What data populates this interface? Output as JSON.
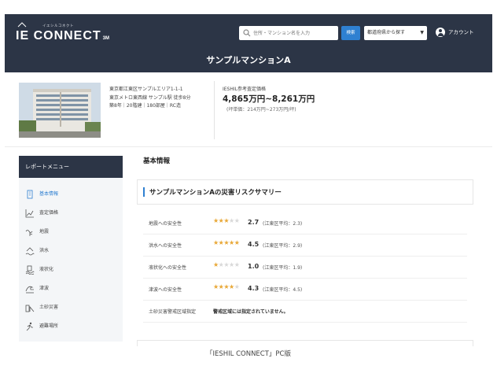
{
  "header": {
    "logo_kana": "イエシルコネクト",
    "logo_text": "IE CONNECT",
    "logo_sub": "3M",
    "search_placeholder": "住所・マンション名を入力",
    "search_button": "検索",
    "pref_button": "都道府県から探す",
    "account": "アカウント",
    "page_title": "サンプルマンションA"
  },
  "property": {
    "address_lines": [
      "東京都江東区サンプルエリア1-1-1",
      "東京メトロ東西線 サンプル駅 徒歩8分",
      "築8年｜20階建｜180部屋｜RC造"
    ],
    "price_label": "IESHIL参考査定価格",
    "price": "4,865万円~8,261万円",
    "price_sub": "(坪単価：214万円~273万円/坪)"
  },
  "sidebar": {
    "title": "レポートメニュー",
    "items": [
      {
        "label": "基本情報",
        "icon": "building-icon"
      },
      {
        "label": "査定価格",
        "icon": "chart-icon"
      },
      {
        "label": "地震",
        "icon": "earthquake-icon"
      },
      {
        "label": "洪水",
        "icon": "house-flood-icon"
      },
      {
        "label": "液状化",
        "icon": "liquefaction-icon"
      },
      {
        "label": "津波",
        "icon": "tsunami-icon"
      },
      {
        "label": "土砂災害",
        "icon": "landslide-icon"
      },
      {
        "label": "避難場所",
        "icon": "evacuation-icon"
      }
    ]
  },
  "main": {
    "section_title": "基本情報",
    "summary_title": "サンプルマンションAの災害リスクサマリー",
    "rows": [
      {
        "label": "地震への安全性",
        "rating": 2.7,
        "score": "2.7",
        "avg": "(江東区平均：2.3)"
      },
      {
        "label": "洪水への安全性",
        "rating": 4.5,
        "score": "4.5",
        "avg": "(江東区平均：2.9)"
      },
      {
        "label": "液状化への安全性",
        "rating": 1.0,
        "score": "1.0",
        "avg": "(江東区平均：1.9)"
      },
      {
        "label": "津波への安全性",
        "rating": 4.3,
        "score": "4.3",
        "avg": "(江東区平均：4.5)"
      }
    ],
    "warning_row": {
      "label": "土砂災害警戒区域指定",
      "text": "警戒区域には指定されていません。"
    }
  },
  "caption": "「IESHIL CONNECT」PC版",
  "colors": {
    "header_bg": "#2c3546",
    "accent": "#2f80d1",
    "star": "#e8a735"
  }
}
